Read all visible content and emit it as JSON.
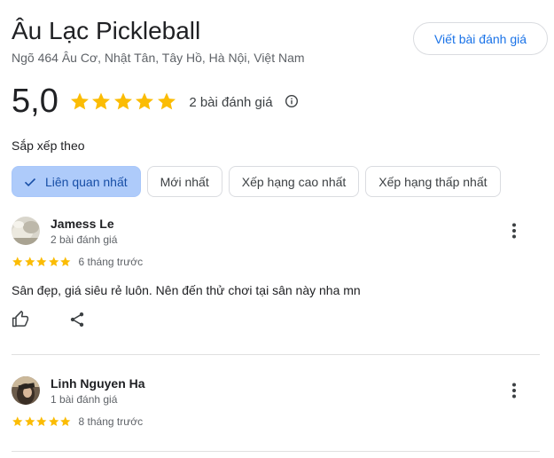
{
  "place": {
    "title": "Âu Lạc Pickleball",
    "address": "Ngõ 464 Âu Cơ, Nhật Tân, Tây Hồ, Hà Nội, Việt Nam",
    "write_review_label": "Viết bài đánh giá",
    "rating_value": "5,0",
    "rating_stars": 5,
    "review_count": "2 bài đánh giá"
  },
  "sort": {
    "label": "Sắp xếp theo",
    "chips": [
      {
        "label": "Liên quan nhất",
        "selected": true
      },
      {
        "label": "Mới nhất",
        "selected": false
      },
      {
        "label": "Xếp hạng cao nhất",
        "selected": false
      },
      {
        "label": "Xếp hạng thấp nhất",
        "selected": false
      }
    ]
  },
  "reviews": [
    {
      "name": "Jamess Le",
      "meta": "2 bài đánh giá",
      "stars": 5,
      "time": "6 tháng trước",
      "text": "Sân đẹp, giá siêu rẻ luôn. Nên đến thử chơi tại sân này nha mn"
    },
    {
      "name": "Linh Nguyen Ha",
      "meta": "1 bài đánh giá",
      "stars": 5,
      "time": "8 tháng trước",
      "text": ""
    }
  ],
  "colors": {
    "star": "#fbbc04",
    "accent": "#1a73e8",
    "selected_chip_bg": "#aecbfa",
    "divider": "#e0e0e0"
  },
  "icons": {
    "star": "star-icon",
    "info": "info-icon",
    "check": "check-icon",
    "more": "more-vert-icon",
    "like": "thumb-up-icon",
    "share": "share-icon"
  }
}
